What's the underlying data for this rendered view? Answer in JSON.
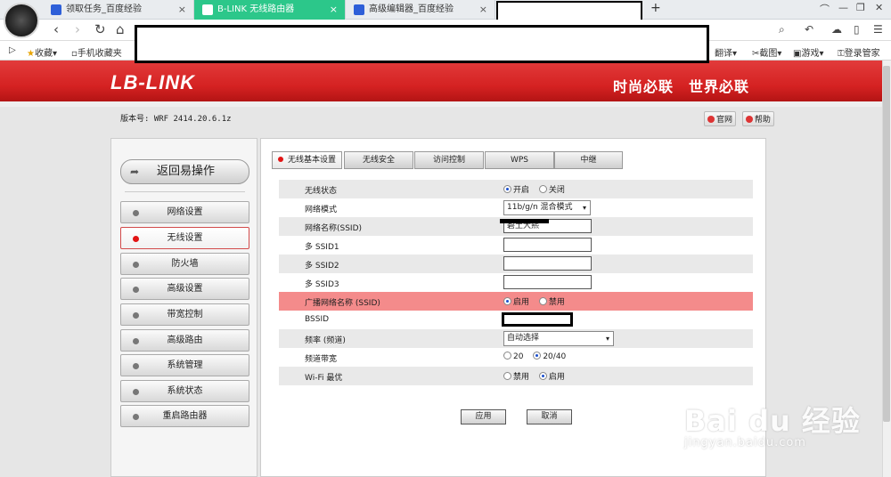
{
  "browser": {
    "tabs": [
      {
        "title": "领取任务_百度经验",
        "active": false
      },
      {
        "title": "B-LINK 无线路由器",
        "active": true
      },
      {
        "title": "高级编辑器_百度经验",
        "active": false
      }
    ],
    "new_tab_symbol": "+",
    "close_symbol": "×",
    "window_controls": [
      "⌒",
      "—",
      "❐",
      "✕"
    ],
    "nav": {
      "back": "‹",
      "forward": "›",
      "refresh": "↻",
      "home": "⌂"
    },
    "right_tools": [
      "⌕",
      "↶",
      "☁",
      "▯",
      "☰"
    ],
    "bookmarks_left": [
      {
        "label": "收藏",
        "caret": "▾"
      },
      {
        "label": "手机收藏夹",
        "caret": ""
      }
    ],
    "bookmarks_right": [
      {
        "label": "翻译",
        "caret": "▾"
      },
      {
        "label": "截图",
        "caret": "▾"
      },
      {
        "label": "游戏",
        "caret": "▾"
      },
      {
        "label": "登录管家",
        "caret": ""
      }
    ]
  },
  "router": {
    "logo": "LB-LINK",
    "slogan": "时尚必联　世界必联",
    "version": "版本号: WRF 2414.20.6.1z",
    "top_links": [
      "官网",
      "帮助"
    ],
    "back_button": "返回易操作",
    "back_arrow": "➦",
    "menu": [
      {
        "label": "网络设置",
        "active": false
      },
      {
        "label": "无线设置",
        "active": true
      },
      {
        "label": "防火墙",
        "active": false
      },
      {
        "label": "高级设置",
        "active": false
      },
      {
        "label": "带宽控制",
        "active": false
      },
      {
        "label": "高级路由",
        "active": false
      },
      {
        "label": "系统管理",
        "active": false
      },
      {
        "label": "系统状态",
        "active": false
      },
      {
        "label": "重启路由器",
        "active": false
      }
    ],
    "panel_tabs": [
      {
        "label": "无线基本设置",
        "active": true
      },
      {
        "label": "无线安全",
        "active": false
      },
      {
        "label": "访问控制",
        "active": false
      },
      {
        "label": "WPS",
        "active": false
      },
      {
        "label": "中继",
        "active": false
      }
    ],
    "settings": {
      "wireless_status": {
        "label": "无线状态",
        "options": [
          "开启",
          "关闭"
        ],
        "selected": 0
      },
      "network_mode": {
        "label": "网络模式",
        "value": "11b/g/n 混合模式"
      },
      "ssid": {
        "label": "网络名称(SSID)",
        "value": "碧土大熙"
      },
      "multi_ssid1": {
        "label": "多 SSID1",
        "value": ""
      },
      "multi_ssid2": {
        "label": "多 SSID2",
        "value": ""
      },
      "multi_ssid3": {
        "label": "多 SSID3",
        "value": ""
      },
      "broadcast_ssid": {
        "label": "广播网络名称 (SSID)",
        "options": [
          "启用",
          "禁用"
        ],
        "selected": 0
      },
      "bssid": {
        "label": "BSSID",
        "value": ""
      },
      "channel": {
        "label": "频率 (频道)",
        "value": "自动选择"
      },
      "bandwidth": {
        "label": "频道带宽",
        "options": [
          "20",
          "20/40"
        ],
        "selected": 1
      },
      "wifi_optimize": {
        "label": "Wi-Fi 最优",
        "options": [
          "禁用",
          "启用"
        ],
        "selected": 1
      }
    },
    "buttons": {
      "apply": "应用",
      "cancel": "取消"
    },
    "caret": "▾"
  },
  "watermark": {
    "line1": "Bai du 经验",
    "line2": "jingyan.baidu.com"
  }
}
